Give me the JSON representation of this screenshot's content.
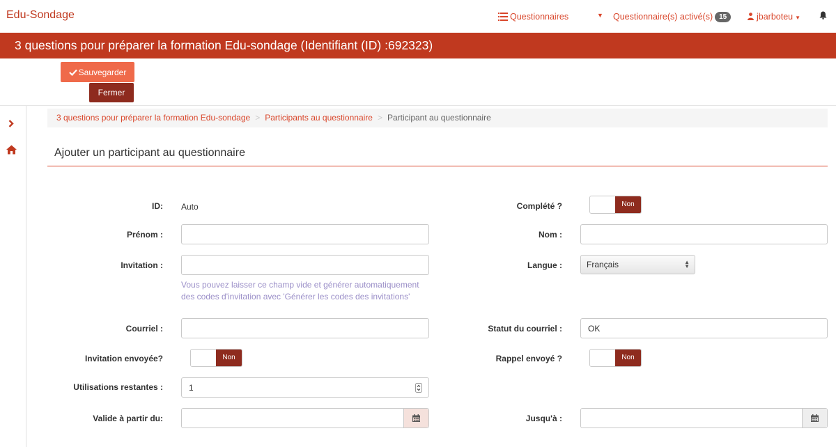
{
  "nav": {
    "brand": "Edu-Sondage",
    "questionnaires": "Questionnaires",
    "activated": "Questionnaire(s) activé(s)",
    "activated_count": "15",
    "user": "jbarboteu"
  },
  "title": "3 questions pour préparer la formation Edu-sondage (Identifiant (ID) :692323)",
  "actions": {
    "save": "Sauvegarder",
    "close": "Fermer"
  },
  "breadcrumb": {
    "items": [
      "3 questions pour préparer la formation Edu-sondage",
      "Participants au questionnaire",
      "Participant au questionnaire"
    ],
    "separator": ">"
  },
  "section_title": "Ajouter un participant au questionnaire",
  "form": {
    "id_label": "ID:",
    "id_value": "Auto",
    "completed_label": "Complété ?",
    "completed_toggle": "Non",
    "firstname_label": "Prénom :",
    "firstname_value": "",
    "lastname_label": "Nom :",
    "lastname_value": "",
    "invitation_label": "Invitation :",
    "invitation_value": "",
    "invitation_hint": "Vous pouvez laisser ce champ vide et générer automatiquement des codes d'invitation avec 'Générer les codes des invitations'",
    "language_label": "Langue :",
    "language_value": "Français",
    "email_label": "Courriel :",
    "email_value": "",
    "email_status_label": "Statut du courriel :",
    "email_status_value": "OK",
    "invitation_sent_label": "Invitation envoyée?",
    "invitation_sent_toggle": "Non",
    "reminder_sent_label": "Rappel envoyé ?",
    "reminder_sent_toggle": "Non",
    "uses_left_label": "Utilisations restantes :",
    "uses_left_value": "1",
    "valid_from_label": "Valide à partir du:",
    "valid_from_value": "",
    "valid_until_label": "Jusqu'à :",
    "valid_until_value": ""
  },
  "colors": {
    "primary": "#c0391f",
    "save_button": "#ef6a4a",
    "dark_button": "#8e2b1e",
    "hint_text": "#9b8fc8"
  },
  "icons": [
    "list-icon",
    "caret-down-icon",
    "user-icon",
    "bell-icon",
    "check-icon",
    "chevron-right-icon",
    "home-icon",
    "spinner-icon",
    "calendar-icon"
  ]
}
